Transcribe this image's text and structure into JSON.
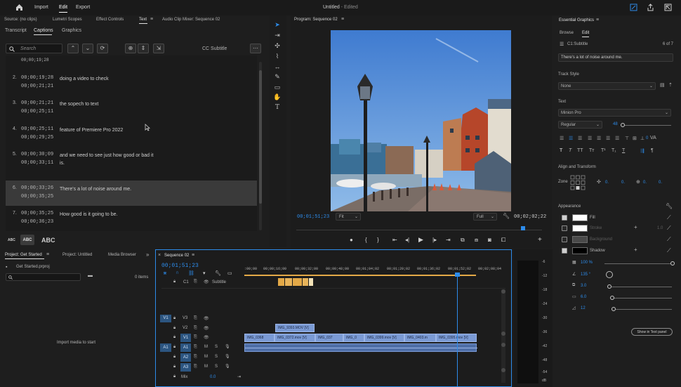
{
  "app": {
    "menu": [
      "Import",
      "Edit",
      "Export"
    ],
    "active_menu": "Edit",
    "title": "Untitled",
    "title_suffix": " - Edited"
  },
  "panel_tabs_top": {
    "source": "Source: (no clips)",
    "lumetri": "Lumetri Scopes",
    "effect_controls": "Effect Controls",
    "text": "Text",
    "audio_mixer": "Audio Clip Mixer: Sequence 02"
  },
  "text_panel": {
    "subtabs": [
      "Transcript",
      "Captions",
      "Graphics"
    ],
    "active_subtab": "Captions",
    "search_placeholder": "Search",
    "track_label": "CC Subtitle",
    "first_line": "00;00;19;28",
    "captions": [
      {
        "num": "2.",
        "in": "00;00;19;28",
        "out": "00;00;21;21",
        "text": "doing a video to check"
      },
      {
        "num": "3.",
        "in": "00;00;21;21",
        "out": "00;00;25;11",
        "text": "the sopech to  text"
      },
      {
        "num": "4.",
        "in": "00;00;25;11",
        "out": "00;00;29;25",
        "text": "feature of Premiere Pro 2022"
      },
      {
        "num": "5.",
        "in": "00;00;30;09",
        "out": "00;00;33;11",
        "text": "and we need to see just how good or bad it is."
      },
      {
        "num": "6.",
        "in": "00;00;33;26",
        "out": "00;00;35;25",
        "text": "There's a lot of noise around me."
      },
      {
        "num": "7.",
        "in": "00;00;35;25",
        "out": "00;00;36;23",
        "text": "How good is it going to be."
      }
    ],
    "selected_index": 4,
    "abc_small": "ABC",
    "abc_medium": "ABC",
    "abc_large": "ABC"
  },
  "program": {
    "title": "Program: Sequence 02",
    "timecode": "00;01;51;23",
    "fit": "Fit",
    "quality": "Full",
    "duration": "00;02;02;22"
  },
  "project": {
    "tabs": [
      "Project: Get Started",
      "Project: Untitled",
      "Media Browser"
    ],
    "file": "Get Started.prproj",
    "items": "0 items",
    "import_hint": "Import media to start"
  },
  "timeline": {
    "tab": "Sequence 02",
    "timecode": "00;01;51;23",
    "ruler": [
      ":00;00",
      "00;00;16;00",
      "00;00;32;00",
      "00;00;48;00",
      "00;01;04;02",
      "00;01;20;02",
      "00;01;36;02",
      "00;01;52;02",
      "00;02;08;04"
    ],
    "subtitle_track": "Subtitle",
    "c1": "C1",
    "video_tracks": [
      "V3",
      "V2",
      "V1"
    ],
    "audio_tracks": [
      "A1",
      "A2",
      "A3"
    ],
    "mix_label": "Mix",
    "mix_value": "0.0",
    "v2_clip": "IMG_9393.MOV [V]",
    "v1_clips": [
      "IMG_0368",
      "IMG_0372.mov [V]",
      "IMG_037",
      "IMG_0",
      "IMG_0399.mov [V]",
      "IMG_0403.m",
      "IMG_0395.mov [V]"
    ],
    "db_levels": [
      "-6",
      "-12",
      "-18",
      "-24",
      "-30",
      "-36",
      "-42",
      "-48",
      "-54",
      "dB"
    ]
  },
  "essential_graphics": {
    "title": "Essential Graphics",
    "tabs": [
      "Browse",
      "Edit"
    ],
    "active_tab": "Edit",
    "layer": "C1:Subtitle",
    "layer_count": "6 of 7",
    "caption_text": "There's a lot of noise around me.",
    "track_style_label": "Track Style",
    "track_style": "None",
    "text_label": "Text",
    "font": "Minion Pro",
    "font_style": "Regular",
    "font_size": "48",
    "tracking": "0",
    "align_label": "Align and Transform",
    "zone_label": "Zone",
    "pos_x": "0.",
    "pos_y": "0.",
    "anchor_x": "0.",
    "anchor_y": "0.",
    "appearance_label": "Appearance",
    "fill": "Fill",
    "stroke": "Stroke",
    "stroke_width": "1.0",
    "background": "Background",
    "shadow": "Shadow",
    "opacity": "100 %",
    "angle": "135 °",
    "distance": "3.0",
    "size": "6.0",
    "blur": "12",
    "show_in_text_panel": "Show in Text panel"
  },
  "colors": {
    "accent": "#2d8ceb",
    "playhead": "#2d8ceb",
    "clip_video": "#7a9ad4",
    "caption_clip": "#e3a947",
    "selected_row": "#3a3a3a"
  }
}
